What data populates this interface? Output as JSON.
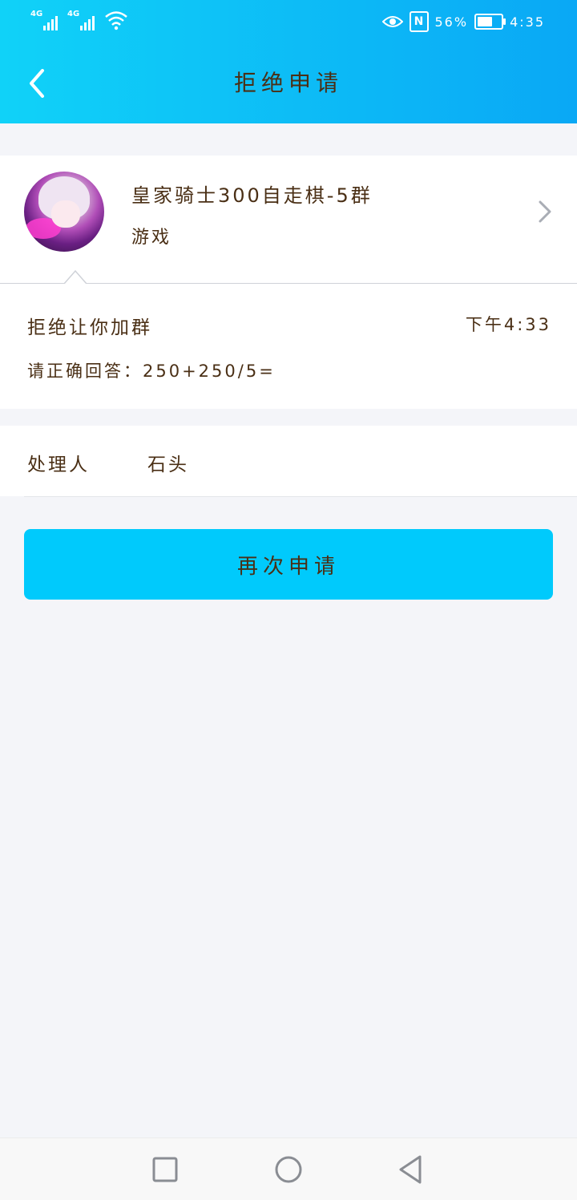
{
  "status_bar": {
    "sim1_label": "4G",
    "sim2_label": "4G",
    "battery_percent": "56%",
    "battery_level": 0.56,
    "time": "4:35",
    "icons": [
      "signal-icon",
      "wifi-icon",
      "eye-comfort-icon",
      "nfc-icon",
      "battery-icon"
    ]
  },
  "header": {
    "title": "拒绝申请",
    "back_icon": "chevron-left-icon",
    "background": "#0fc4f7"
  },
  "group": {
    "name": "皇家骑士300自走棋-5群",
    "category": "游戏",
    "chevron_icon": "chevron-right-icon"
  },
  "message": {
    "title": "拒绝让你加群",
    "time": "下午4:33",
    "question": "请正确回答：250+250/5="
  },
  "handler": {
    "label": "处理人",
    "value": "石头"
  },
  "actions": {
    "reapply_label": "再次申请",
    "button_color": "#00cafc"
  },
  "nav_bar": {
    "icons": [
      "recent-apps-icon",
      "home-icon",
      "back-icon"
    ]
  }
}
